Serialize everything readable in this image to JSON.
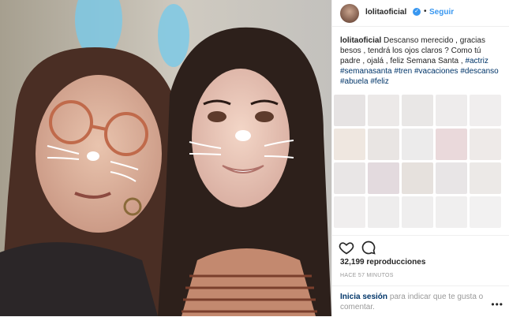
{
  "post": {
    "username": "lolitaoficial",
    "follow_label": "Seguir",
    "dot": "•"
  },
  "caption": {
    "username": "lolitaoficial",
    "text": "Descanso merecido , gracias besos , tendrá los ojos claros ? Como tú padre , ojalá , feliz Semana Santa ,",
    "tags": [
      "#actriz",
      "#semanasanta",
      "#tren",
      "#vacaciones",
      "#descanso",
      "#abuela",
      "#feliz"
    ]
  },
  "stats": {
    "views": "32,199 reproducciones",
    "time_ago": "HACE 57 MINUTOS"
  },
  "footer": {
    "login_link": "Inicia sesión",
    "login_text": "para indicar que te gusta o comentar.",
    "more": "•••"
  },
  "icons": {
    "verified": "verified-badge-icon",
    "like": "heart-icon",
    "comment": "comment-icon"
  },
  "colors": {
    "link_blue": "#3897f0",
    "hashtag": "#003569",
    "muted": "#999999"
  }
}
